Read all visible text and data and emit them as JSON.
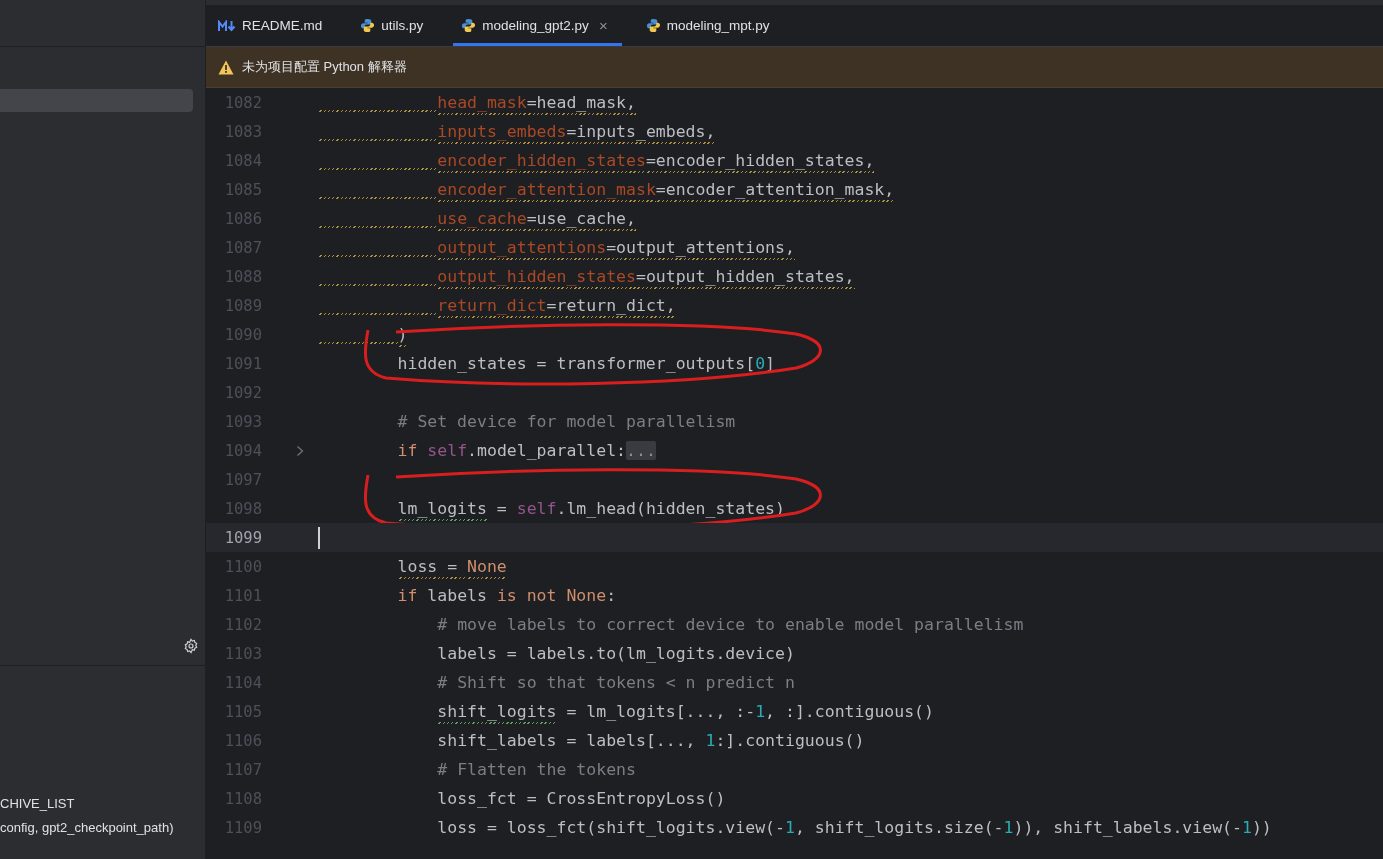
{
  "sidebar": {
    "row_selected": true,
    "bottom_lines": [
      {
        "text": "CHIVE_LIST"
      },
      {
        "text": "config, gpt2_checkpoint_path)"
      }
    ]
  },
  "tabs": [
    {
      "label": "README.md",
      "kind": "markdown",
      "selected": false,
      "closable": false
    },
    {
      "label": "utils.py",
      "kind": "python",
      "selected": false,
      "closable": false
    },
    {
      "label": "modeling_gpt2.py",
      "kind": "python",
      "selected": true,
      "closable": true
    },
    {
      "label": "modeling_mpt.py",
      "kind": "python",
      "selected": false,
      "closable": false
    }
  ],
  "banner": {
    "text": "未为项目配置 Python 解释器"
  },
  "close_glyph": "×",
  "lines": [
    {
      "number": "1082",
      "kind": "nested",
      "indent_warning": true,
      "segments": [
        {
          "text": "head_mask",
          "kind": "param",
          "warning": true
        },
        {
          "text": "=head_mask,",
          "warning": true
        }
      ]
    },
    {
      "number": "1083",
      "kind": "nested",
      "indent_warning": true,
      "segments": [
        {
          "text": "inputs_embeds",
          "kind": "param",
          "warning": true
        },
        {
          "text": "=inputs_embeds,",
          "warning": true
        }
      ]
    },
    {
      "number": "1084",
      "kind": "nested",
      "indent_warning": true,
      "segments": [
        {
          "text": "encoder_hidden_states",
          "kind": "param",
          "warning": true
        },
        {
          "text": "=encoder_hidden_states,",
          "warning": true
        }
      ]
    },
    {
      "number": "1085",
      "kind": "nested",
      "indent_warning": true,
      "segments": [
        {
          "text": "encoder_attention_mask",
          "kind": "param",
          "warning": true
        },
        {
          "text": "=encoder_attention_mask,",
          "warning": true
        }
      ]
    },
    {
      "number": "1086",
      "kind": "nested",
      "indent_warning": true,
      "segments": [
        {
          "text": "use_cache",
          "kind": "param",
          "warning": true
        },
        {
          "text": "=use_cache,",
          "warning": true
        }
      ]
    },
    {
      "number": "1087",
      "kind": "nested",
      "indent_warning": true,
      "segments": [
        {
          "text": "output_attentions",
          "kind": "param",
          "warning": true
        },
        {
          "text": "=output_attentions,",
          "warning": true
        }
      ]
    },
    {
      "number": "1088",
      "kind": "nested",
      "indent_warning": true,
      "segments": [
        {
          "text": "output_hidden_states",
          "kind": "param",
          "warning": true
        },
        {
          "text": "=output_hidden_states,",
          "warning": true
        }
      ]
    },
    {
      "number": "1089",
      "kind": "nested",
      "indent_warning": true,
      "segments": [
        {
          "text": "return_dict",
          "kind": "param",
          "warning": true
        },
        {
          "text": "=return_dict,",
          "warning": true
        }
      ]
    },
    {
      "number": "1090",
      "kind": "body",
      "indent_warning": true,
      "segments": [
        {
          "text": ")",
          "warning": true
        }
      ]
    },
    {
      "number": "1091",
      "kind": "body",
      "circled": true,
      "segments": [
        {
          "text": "hidden_states = transformer_outputs["
        },
        {
          "text": "0",
          "kind": "number"
        },
        {
          "text": "]"
        }
      ]
    },
    {
      "number": "1092"
    },
    {
      "number": "1093",
      "kind": "body",
      "segments": [
        {
          "text": "# Set device for model parallelism",
          "kind": "comment"
        }
      ]
    },
    {
      "number": "1094",
      "kind": "body",
      "folded": true,
      "segments": [
        {
          "text": "if",
          "kind": "keyword"
        },
        {
          "text": "self",
          "kind": "self",
          "space_before": true
        },
        {
          "text": ".model_parallel:"
        },
        {
          "text": "...",
          "kind": "fold"
        }
      ]
    },
    {
      "number": "1097"
    },
    {
      "number": "1098",
      "kind": "body",
      "circled": true,
      "segments": [
        {
          "text": "lm_logits",
          "typo": true
        },
        {
          "text": " = "
        },
        {
          "text": "self",
          "kind": "self"
        },
        {
          "text": ".lm_head(hidden_states)"
        }
      ]
    },
    {
      "number": "1099",
      "current": true
    },
    {
      "number": "1100",
      "kind": "body",
      "segments": [
        {
          "text": "loss = ",
          "warning": true
        },
        {
          "text": "None",
          "kind": "keyword",
          "warning": true
        }
      ]
    },
    {
      "number": "1101",
      "kind": "body",
      "segments": [
        {
          "text": "if",
          "kind": "keyword"
        },
        {
          "text": " labels "
        },
        {
          "text": "is not None",
          "kind": "keyword"
        },
        {
          "text": ":"
        }
      ]
    },
    {
      "number": "1102",
      "kind": "nested",
      "segments": [
        {
          "text": "# move labels to correct device to enable model parallelism",
          "kind": "comment"
        }
      ]
    },
    {
      "number": "1103",
      "kind": "nested",
      "segments": [
        {
          "text": "labels = labels.to(lm_logits.device)"
        }
      ]
    },
    {
      "number": "1104",
      "kind": "nested",
      "segments": [
        {
          "text": "# Shift so that tokens < n predict n",
          "kind": "comment"
        }
      ]
    },
    {
      "number": "1105",
      "kind": "nested",
      "segments": [
        {
          "text": "shift_logits",
          "typo": true
        },
        {
          "text": " = lm_logits[..., :-"
        },
        {
          "text": "1",
          "kind": "number"
        },
        {
          "text": ", :].contiguous()"
        }
      ]
    },
    {
      "number": "1106",
      "kind": "nested",
      "segments": [
        {
          "text": "shift_labels = labels[..., "
        },
        {
          "text": "1",
          "kind": "number"
        },
        {
          "text": ":].contiguous()"
        }
      ]
    },
    {
      "number": "1107",
      "kind": "nested",
      "segments": [
        {
          "text": "# Flatten the tokens",
          "kind": "comment"
        }
      ]
    },
    {
      "number": "1108",
      "kind": "nested",
      "segments": [
        {
          "text": "loss_fct = CrossEntropyLoss()"
        }
      ]
    },
    {
      "number": "1109",
      "kind": "nested",
      "segments": [
        {
          "text": "loss = loss_fct(shift_logits.view(-"
        },
        {
          "text": "1",
          "kind": "number"
        },
        {
          "text": ", shift_logits.size(-"
        },
        {
          "text": "1",
          "kind": "number"
        },
        {
          "text": ")), shift_labels.view(-"
        },
        {
          "text": "1",
          "kind": "number"
        },
        {
          "text": "))"
        }
      ]
    }
  ]
}
